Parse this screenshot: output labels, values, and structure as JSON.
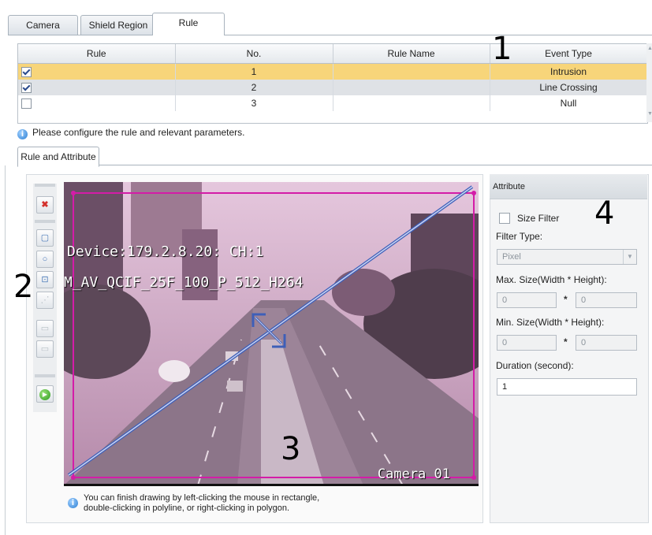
{
  "tabs": [
    {
      "label": "Camera"
    },
    {
      "label": "Shield Region"
    },
    {
      "label": "Rule",
      "active": true
    }
  ],
  "rules_table": {
    "headers": [
      "Rule",
      "No.",
      "Rule Name",
      "Event Type"
    ],
    "rows": [
      {
        "checked": true,
        "no": "1",
        "name": "",
        "event": "Intrusion",
        "selected": true
      },
      {
        "checked": true,
        "no": "2",
        "name": "",
        "event": "Line Crossing",
        "selected": false
      },
      {
        "checked": false,
        "no": "3",
        "name": "",
        "event": "Null",
        "selected": false
      }
    ]
  },
  "hint_configure": "Please configure the  rule and relevant parameters.",
  "subtab_label": "Rule and Attribute",
  "video": {
    "osd_line1": "Device:179.2.8.20: CH:1",
    "osd_line2": "M_AV_QCIF_25F_100_P_512_H264",
    "osd_camera": "Camera 01"
  },
  "draw_hint": {
    "line1": "You can finish drawing by left-clicking the mouse in rectangle,",
    "line2": "double-clicking in polyline, or right-clicking in polygon."
  },
  "attribute": {
    "header": "Attribute",
    "size_filter_label": "Size Filter",
    "size_filter_checked": false,
    "filter_type_label": "Filter Type:",
    "filter_type_value": "Pixel",
    "max_size_label": "Max. Size(Width * Height):",
    "max_width": "0",
    "max_height": "0",
    "min_size_label": "Min. Size(Width * Height):",
    "min_width": "0",
    "min_height": "0",
    "multiply_symbol": "*",
    "duration_label": "Duration (second):",
    "duration_value": "1"
  },
  "markers": {
    "m1": "1",
    "m2": "2",
    "m3": "3",
    "m4": "4"
  },
  "colors": {
    "selected_row": "#f7d57a",
    "alt_row": "#dfe2e6",
    "region": "#d41ca8",
    "line": "#3e5fb8"
  },
  "icons": [
    "delete-icon",
    "rectangle-icon",
    "search-icon",
    "target-icon",
    "play-icon"
  ]
}
